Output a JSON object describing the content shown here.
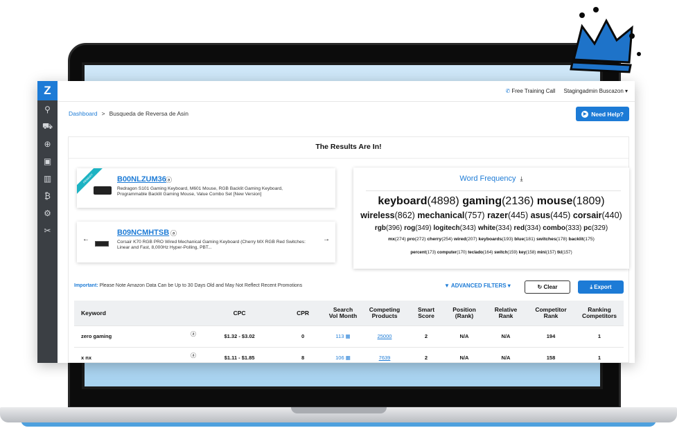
{
  "topbar": {
    "call_label": "Free Training Call",
    "user_label": "Stagingadmin Buscazon ▾"
  },
  "breadcrumb": {
    "root": "Dashboard",
    "separator": ">",
    "current": "Busqueda de Reversa de Asin"
  },
  "help_button": "Need Help?",
  "results_title": "The Results Are In!",
  "products": [
    {
      "asin": "B00NLZUM36",
      "ribbon": "PRIMARY",
      "title": "Redragon S101 Gaming Keyboard, M601 Mouse, RGB Backlit Gaming Keyboard, Programmable Backlit Gaming Mouse, Value Combo Set [New Version]"
    },
    {
      "asin": "B09NCMHTSB",
      "title": "Corsair K70 RGB PRO Wired Mechanical Gaming Keyboard (Cherry MX RGB Red Switches: Linear and Fast, 8,000Hz Hyper-Polling, PBT..."
    }
  ],
  "word_frequency": {
    "title": "Word Frequency",
    "line1": [
      {
        "w": "keyboard",
        "n": "(4898)"
      },
      {
        "w": "gaming",
        "n": "(2136)"
      },
      {
        "w": "mouse",
        "n": "(1809)"
      }
    ],
    "line2": [
      {
        "w": "wireless",
        "n": "(862)"
      },
      {
        "w": "mechanical",
        "n": "(757)"
      },
      {
        "w": "razer",
        "n": "(445)"
      },
      {
        "w": "asus",
        "n": "(445)"
      },
      {
        "w": "corsair",
        "n": "(440)"
      }
    ],
    "line3": [
      {
        "w": "rgb",
        "n": "(396)"
      },
      {
        "w": "rog",
        "n": "(349)"
      },
      {
        "w": "logitech",
        "n": "(343)"
      },
      {
        "w": "white",
        "n": "(334)"
      },
      {
        "w": "red",
        "n": "(334)"
      },
      {
        "w": "combo",
        "n": "(333)"
      },
      {
        "w": "pc",
        "n": "(329)"
      }
    ],
    "line4": [
      {
        "w": "mx",
        "n": "(274)"
      },
      {
        "w": "pro",
        "n": "(272)"
      },
      {
        "w": "cherry",
        "n": "(254)"
      },
      {
        "w": "wired",
        "n": "(207)"
      },
      {
        "w": "keyboards",
        "n": "(193)"
      },
      {
        "w": "blue",
        "n": "(181)"
      },
      {
        "w": "switches",
        "n": "(178)"
      },
      {
        "w": "backlit",
        "n": "(175)"
      }
    ],
    "line5": [
      {
        "w": "percent",
        "n": "(173)"
      },
      {
        "w": "computer",
        "n": "(170)"
      },
      {
        "w": "teclado",
        "n": "(164)"
      },
      {
        "w": "switch",
        "n": "(159)"
      },
      {
        "w": "key",
        "n": "(158)"
      },
      {
        "w": "mini",
        "n": "(157)"
      },
      {
        "w": "tkl",
        "n": "(157)"
      }
    ]
  },
  "notice": {
    "label": "Important:",
    "text": "Please Note Amazon Data Can be Up to 30 Days Old and May Not Reflect Recent Promotions"
  },
  "filters": {
    "advanced": "ADVANCED FILTERS ▾",
    "clear": "Clear",
    "export": "Export"
  },
  "table": {
    "headers": [
      "Keyword",
      "CPC",
      "CPR",
      "Search Vol Month",
      "Competing Products",
      "Smart Score",
      "Position (Rank)",
      "Relative Rank",
      "Competitor Rank",
      "Ranking Competitors"
    ],
    "rows": [
      {
        "keyword": "zero gaming",
        "cpc": "$1.32 - $3.02",
        "cpr": "0",
        "search_vol": "113",
        "competing": "25000",
        "smart": "2",
        "position": "N/A",
        "relative": "N/A",
        "competitor_rank": "194",
        "ranking_competitors": "1"
      },
      {
        "keyword": "x nx",
        "cpc": "$1.11 - $1.85",
        "cpr": "8",
        "search_vol": "106",
        "competing": "7639",
        "smart": "2",
        "position": "N/A",
        "relative": "N/A",
        "competitor_rank": "158",
        "ranking_competitors": "1"
      }
    ]
  },
  "colors": {
    "accent": "#1d7bd6",
    "rail": "#3b3f44",
    "crown": "#1e73c9"
  }
}
